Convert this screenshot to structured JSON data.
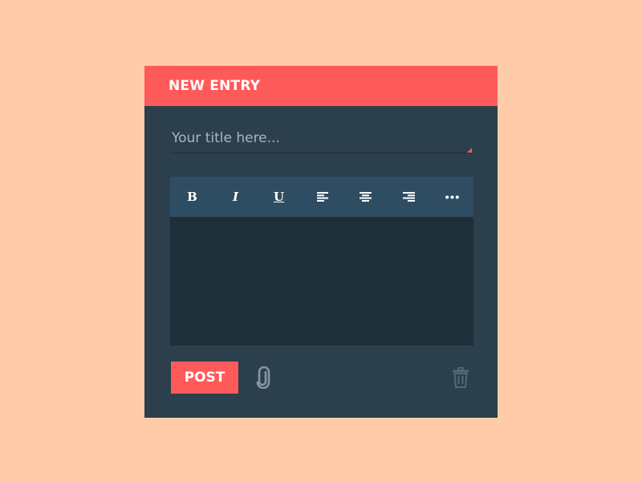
{
  "card": {
    "title": "NEW ENTRY"
  },
  "title_input": {
    "placeholder": "Your title here..."
  },
  "toolbar": {
    "bold_label": "B",
    "italic_label": "I",
    "underline_label": "U",
    "icons": [
      "bold-icon",
      "italic-icon",
      "underline-icon",
      "align-left-icon",
      "align-center-icon",
      "align-right-icon",
      "more-icon"
    ]
  },
  "footer": {
    "post_label": "POST",
    "icons": [
      "paperclip-icon",
      "trash-icon"
    ]
  },
  "colors": {
    "background": "#FFCBA9",
    "card": "#2B3F4C",
    "accent": "#FF5A5A",
    "toolbar": "#2F4D62",
    "editor_body": "#1E2F3A",
    "muted_icon": "#8596A2"
  }
}
